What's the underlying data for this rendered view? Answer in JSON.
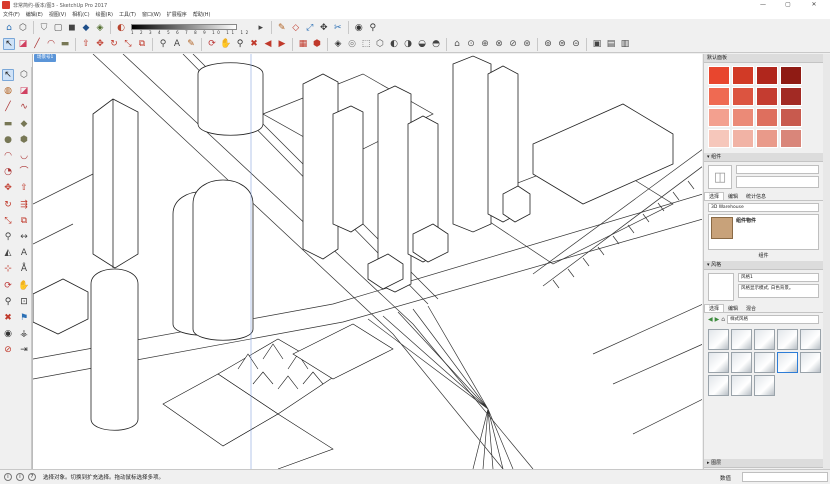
{
  "window": {
    "title": "非常简约-版本/图3 - SketchUp Pro 2017",
    "controls": [
      "—",
      "▢",
      "✕"
    ]
  },
  "menu": [
    "文件(F)",
    "编辑(E)",
    "视图(V)",
    "相机(C)",
    "绘图(R)",
    "工具(T)",
    "窗口(W)",
    "扩展程序",
    "帮助(H)"
  ],
  "toolbar_row1": {
    "icons": [
      "house-icon",
      "box-icon",
      "shield-icon",
      "cube-outline-icon",
      "cube-solid-icon",
      "cube-shaded-icon",
      "cube-texture-icon"
    ],
    "palette_numbers": "1 2 3 4 5 6 7 8 9 10 11 12",
    "right_icons": [
      "paint-icon",
      "section-icon",
      "measure-icon",
      "move-icon",
      "tape-icon",
      "eye-icon",
      "foot-icon"
    ]
  },
  "toolbar_row2": {
    "icons": [
      "select-arrow-icon",
      "eraser-icon",
      "pencil-icon",
      "arc-icon",
      "rectangle-icon",
      "pushpull-icon",
      "move-icon",
      "rotate-icon",
      "scale-icon",
      "offset-icon",
      "tape-icon",
      "text-icon",
      "paint-icon",
      "orbit-icon",
      "pan-icon",
      "zoom-icon",
      "zoom-extents-icon",
      "previous-view-icon",
      "next-view-icon",
      "warehouse-icon",
      "extension-icon",
      "styles-icon",
      "xray-icon",
      "backedges-icon",
      "wireframe-icon",
      "hiddenline-icon",
      "shaded-icon",
      "textured-icon",
      "monochrome-icon",
      "iso-icon",
      "top-icon",
      "front-icon",
      "right-icon",
      "back-icon",
      "left-icon",
      "section-plane-icon",
      "display-section-icon",
      "section-cut-icon"
    ]
  },
  "scene_tab": "场景号1",
  "left_tools": [
    "select-arrow-icon",
    "component-icon",
    "paint-icon",
    "eraser-icon",
    "line-icon",
    "freehand-icon",
    "rectangle-icon",
    "rotated-rect-icon",
    "circle-icon",
    "polygon-icon",
    "arc-icon",
    "arc2-icon",
    "pie-icon",
    "arc3-icon",
    "move-icon",
    "pushpull-icon",
    "rotate-icon",
    "followme-icon",
    "scale-icon",
    "offset-icon",
    "tape-icon",
    "dimension-icon",
    "protractor-icon",
    "text-icon",
    "axes-icon",
    "3dtext-icon",
    "orbit-icon",
    "pan-icon",
    "zoom-icon",
    "zoom-window-icon",
    "zoom-extents-icon",
    "position-camera-icon",
    "lookaround-icon",
    "walk-icon",
    "section-icon",
    "sandbox-icon"
  ],
  "tray": {
    "colors_panel": {
      "title": "默认面板",
      "swatches": [
        "#e8462e",
        "#d13a26",
        "#b0261c",
        "#8f1b14",
        "#ef6a52",
        "#dc5440",
        "#c43c30",
        "#a22a24",
        "#f3a08f",
        "#eb8a77",
        "#de6f5e",
        "#c85a4e",
        "#f6c7bb",
        "#f1b3a5",
        "#e99a8a",
        "#d9867a"
      ]
    },
    "components_panel": {
      "title": "组件",
      "tabs": [
        "选择",
        "编辑",
        "统计信息"
      ],
      "search_value": "3D Warehouse",
      "item_label": "组件物件",
      "footer": "组件"
    },
    "styles_panel": {
      "title": "风格",
      "style_name": "风格1",
      "style_desc": "风格显示模式, 白色背景。",
      "tabs": [
        "选择",
        "编辑",
        "混合"
      ],
      "dropdown_value": "样式风格"
    },
    "layers_panel": {
      "title": "图层"
    }
  },
  "status": {
    "message": "选择对象。切换到扩充选择。拖动鼠标选择多项。",
    "value_label": "数值",
    "value": ""
  }
}
